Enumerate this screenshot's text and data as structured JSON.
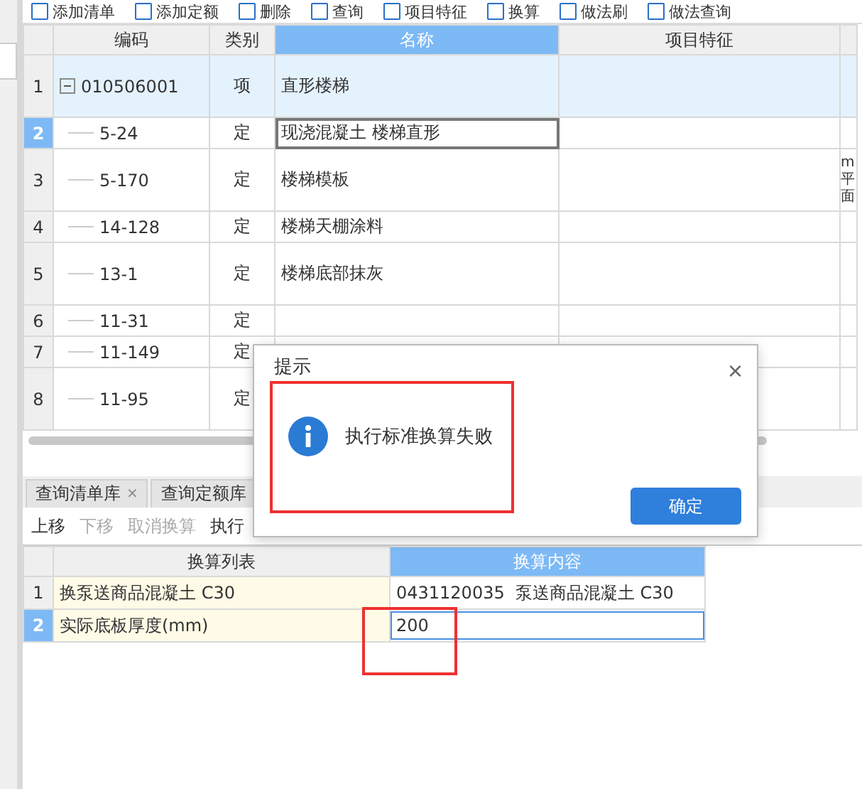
{
  "toolbar": [
    {
      "label": "添加清单"
    },
    {
      "label": "添加定额"
    },
    {
      "label": "删除"
    },
    {
      "label": "查询"
    },
    {
      "label": "项目特征"
    },
    {
      "label": "换算"
    },
    {
      "label": "做法刷"
    },
    {
      "label": "做法查询"
    }
  ],
  "grid": {
    "columns": [
      {
        "label": "编码",
        "selected": false
      },
      {
        "label": "类别",
        "selected": false
      },
      {
        "label": "名称",
        "selected": true
      },
      {
        "label": "项目特征",
        "selected": false
      }
    ],
    "rows": [
      {
        "num": "1",
        "code": "010506001",
        "type": "项",
        "name": "直形楼梯",
        "expanded": true,
        "selected": false,
        "tall": true,
        "editing": false,
        "children": [
          {
            "num": "2",
            "code": "5-24",
            "type": "定",
            "name": "现浇混凝土 楼梯直形",
            "selected": true,
            "tall": false,
            "editing": true
          },
          {
            "num": "3",
            "code": "5-170",
            "type": "定",
            "name": "楼梯模板",
            "column_5": "m平面",
            "selected": false,
            "tall": true,
            "editing": false
          },
          {
            "num": "4",
            "code": "14-128",
            "type": "定",
            "name": "楼梯天棚涂料",
            "selected": false,
            "tall": false,
            "editing": false
          },
          {
            "num": "5",
            "code": "13-1",
            "type": "定",
            "name": "楼梯底部抹灰",
            "selected": false,
            "tall": true,
            "editing": false
          },
          {
            "num": "6",
            "code": "11-31",
            "type": "定",
            "selected": false,
            "tall": false,
            "editing": false
          },
          {
            "num": "7",
            "code": "11-149",
            "type": "定",
            "selected": false,
            "tall": false,
            "editing": false
          },
          {
            "num": "8",
            "code": "11-95",
            "type": "定",
            "selected": false,
            "tall": true,
            "editing": false
          }
        ]
      }
    ]
  },
  "bottom_tabs": [
    {
      "label": "查询清单库",
      "close": "×",
      "selected": false
    },
    {
      "label": "查询定额库",
      "selected": false
    }
  ],
  "actions": [
    {
      "label": "上移",
      "disabled": false
    },
    {
      "label": "下移",
      "disabled": true
    },
    {
      "label": "取消换算",
      "disabled": true
    },
    {
      "label": "执行",
      "disabled": false
    }
  ],
  "conversion": {
    "columns": [
      {
        "label": "换算列表",
        "selected": false
      },
      {
        "label": "换算内容",
        "selected": true
      }
    ],
    "rows": [
      {
        "num": "1",
        "item": "换泵送商品混凝土 C30",
        "content": "0431120035  泵送商品混凝土 C30",
        "selected": false,
        "editing": false
      },
      {
        "num": "2",
        "item": "实际底板厚度(mm)",
        "content": "200",
        "selected": true,
        "editing": true
      }
    ]
  },
  "dialog": {
    "title": "提示",
    "close": "×",
    "message": "执行标准换算失败",
    "button": "确定"
  }
}
